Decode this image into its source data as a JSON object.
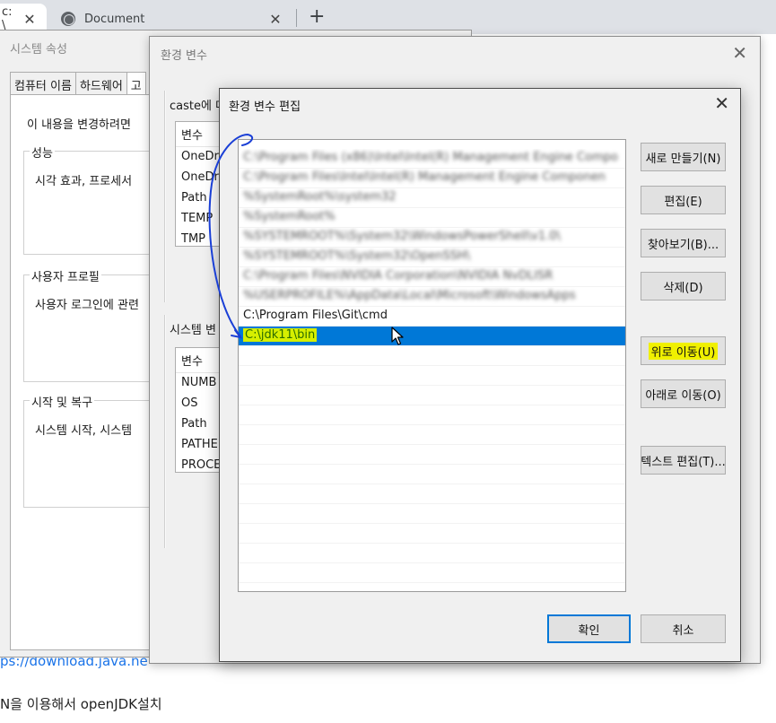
{
  "browser": {
    "tabs": [
      {
        "label": "c: \\",
        "close": "✕"
      },
      {
        "label": "Document",
        "close": "✕"
      }
    ],
    "new_tab": "+"
  },
  "background_page": {
    "link_fragment": "ps://download.java.ne",
    "text_fragment": "N을 이용해서 openJDK설치"
  },
  "system_properties": {
    "title": "시스템 속성",
    "tabs": [
      "컴퓨터 이름",
      "하드웨어",
      "고"
    ],
    "intro": "이 내용을 변경하려면",
    "groups": [
      {
        "title": "성능",
        "body": "시각 효과, 프로세서"
      },
      {
        "title": "사용자 프로필",
        "body": "사용자 로그인에 관련"
      },
      {
        "title": "시작 및 복구",
        "body": "시스템 시작, 시스템"
      }
    ]
  },
  "environment_variables": {
    "title": "환경 변수",
    "close": "✕",
    "user_section_label": "caste에 대",
    "user_list": {
      "header": "변수",
      "rows": [
        "OneDri",
        "OneDri",
        "Path",
        "TEMP",
        "TMP"
      ]
    },
    "system_section_label": "시스템 변",
    "system_list": {
      "header": "변수",
      "rows": [
        "NUMB",
        "OS",
        "Path",
        "PATHE",
        "PROCE"
      ]
    }
  },
  "edit_dialog": {
    "title": "환경 변수 편집",
    "close": "✕",
    "paths": [
      "C:\\Program Files (x86)\\Intel\\Intel(R) Management Engine Compo",
      "C:\\Program Files\\Intel\\Intel(R) Management Engine Componen",
      "%SystemRoot%\\system32",
      "%SystemRoot%",
      "%SYSTEMROOT%\\System32\\WindowsPowerShell\\v1.0\\",
      "%SYSTEMROOT%\\System32\\OpenSSH\\",
      "C:\\Program Files\\NVIDIA Corporation\\NVIDIA NvDLISR",
      "%USERPROFILE%\\AppData\\Local\\Microsoft\\WindowsApps",
      "C:\\Program Files\\Git\\cmd",
      "C:\\jdk11\\bin"
    ],
    "selected_index": 9,
    "buttons": {
      "new": "새로 만들기(N)",
      "edit": "편집(E)",
      "browse": "찾아보기(B)...",
      "delete": "삭제(D)",
      "move_up": "위로 이동(U)",
      "move_down": "아래로 이동(O)",
      "edit_text": "텍스트 편집(T)...",
      "ok": "확인",
      "cancel": "취소"
    },
    "colors": {
      "selection": "#0078d7",
      "highlight": "#f0f000",
      "annotation": "#1a3fd6"
    }
  }
}
